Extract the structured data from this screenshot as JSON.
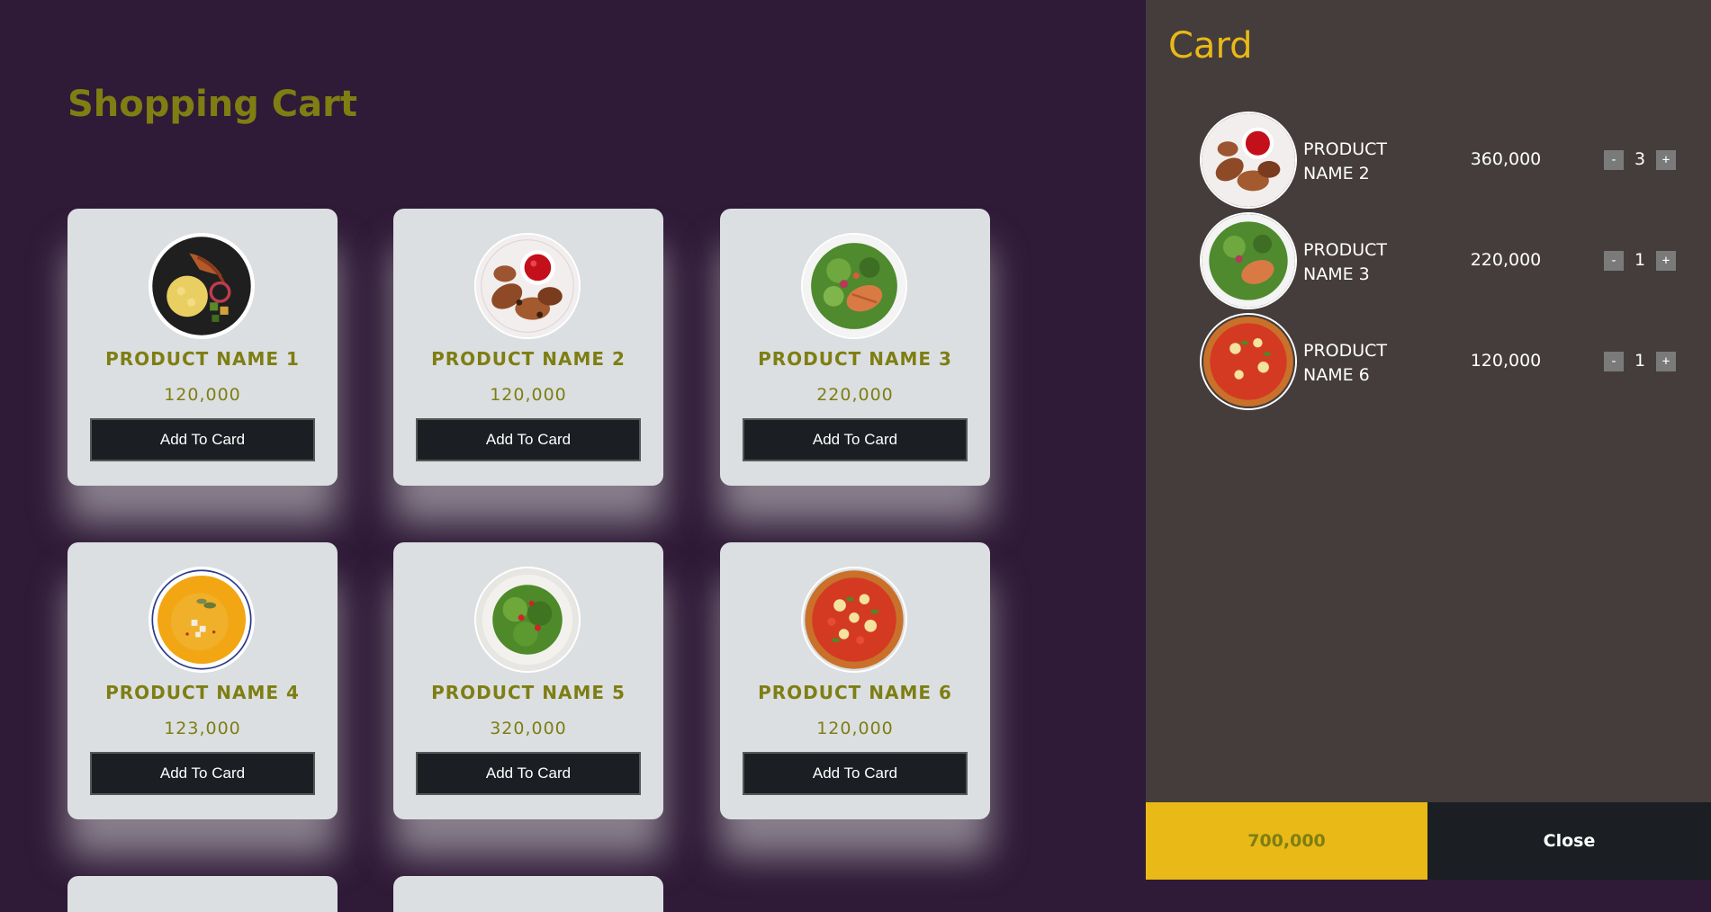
{
  "page": {
    "title": "Shopping Cart"
  },
  "products": [
    {
      "name": "PRODUCT NAME 1",
      "price": "120,000",
      "button_label": "Add To Card",
      "image": "noodle-bowl-image"
    },
    {
      "name": "PRODUCT NAME 2",
      "price": "120,000",
      "button_label": "Add To Card",
      "image": "chicken-wings-image"
    },
    {
      "name": "PRODUCT NAME 3",
      "price": "220,000",
      "button_label": "Add To Card",
      "image": "salmon-salad-image"
    },
    {
      "name": "PRODUCT NAME 4",
      "price": "123,000",
      "button_label": "Add To Card",
      "image": "pumpkin-soup-image"
    },
    {
      "name": "PRODUCT NAME 5",
      "price": "320,000",
      "button_label": "Add To Card",
      "image": "green-salad-image"
    },
    {
      "name": "PRODUCT NAME 6",
      "price": "120,000",
      "button_label": "Add To Card",
      "image": "pizza-image"
    }
  ],
  "cart": {
    "title": "Card",
    "items": [
      {
        "name": "PRODUCT NAME 2",
        "price": "360,000",
        "quantity": "3",
        "minus_label": "-",
        "plus_label": "+",
        "image": "chicken-wings-image"
      },
      {
        "name": "PRODUCT NAME 3",
        "price": "220,000",
        "quantity": "1",
        "minus_label": "-",
        "plus_label": "+",
        "image": "salmon-salad-image"
      },
      {
        "name": "PRODUCT NAME 6",
        "price": "120,000",
        "quantity": "1",
        "minus_label": "-",
        "plus_label": "+",
        "image": "pizza-image"
      }
    ],
    "total": "700,000",
    "close_label": "Close"
  },
  "colors": {
    "background": "#2f1a37",
    "accent_olive": "#7e7e13",
    "accent_gold": "#e8b917",
    "card_bg": "#dcdfe1",
    "button_dark": "#1b1e22",
    "panel_bg": "#453d3b"
  }
}
